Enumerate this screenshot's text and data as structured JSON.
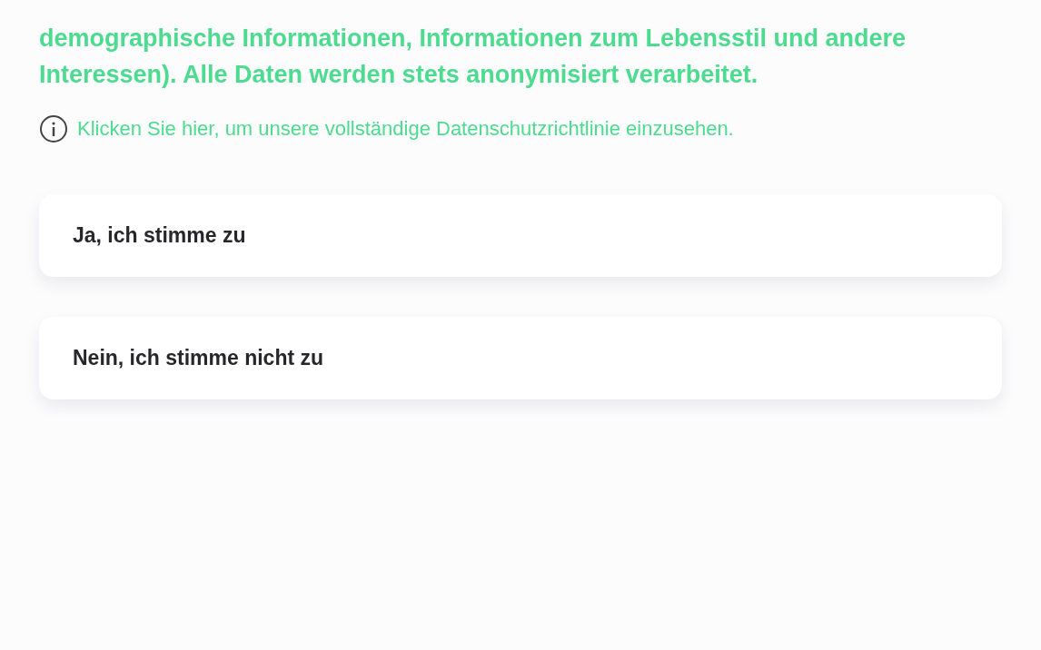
{
  "consent_text": "demographische Informationen, Informationen zum Lebensstil und andere Interessen). Alle Daten werden stets anonymisiert verarbeitet.",
  "privacy_link": {
    "label": "Klicken Sie hier, um unsere vollständige Datenschutzrichtlinie einzusehen."
  },
  "options": [
    {
      "label": "Ja, ich stimme zu",
      "selected": false
    },
    {
      "label": "Nein, ich stimme nicht zu",
      "selected": false
    }
  ]
}
